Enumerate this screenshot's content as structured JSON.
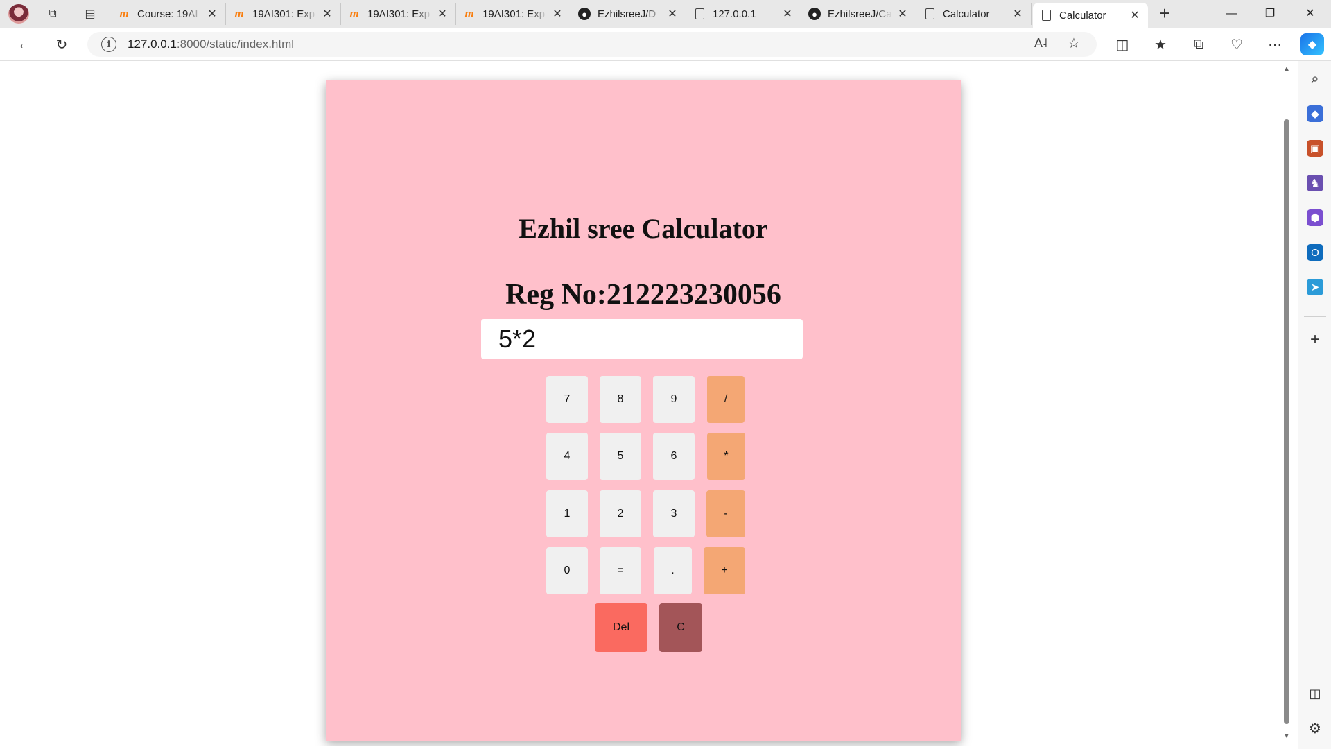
{
  "browser": {
    "tabs": [
      {
        "title": "Course: 19AI",
        "icon": "moodle-icon",
        "active": false
      },
      {
        "title": "19AI301: Exp",
        "icon": "moodle-icon",
        "active": false
      },
      {
        "title": "19AI301: Exp",
        "icon": "moodle-icon",
        "active": false
      },
      {
        "title": "19AI301: Exp",
        "icon": "moodle-icon",
        "active": false
      },
      {
        "title": "EzhilsreeJ/D",
        "icon": "github-icon",
        "active": false
      },
      {
        "title": "127.0.0.1",
        "icon": "page-icon",
        "active": false
      },
      {
        "title": "EzhilsreeJ/Ca",
        "icon": "github-icon",
        "active": false
      },
      {
        "title": "Calculator",
        "icon": "page-icon",
        "active": false
      },
      {
        "title": "Calculator",
        "icon": "page-icon",
        "active": true
      }
    ],
    "address": {
      "host": "127.0.0.1",
      "path": ":8000/static/index.html"
    }
  },
  "calculator": {
    "title": "Ezhil sree Calculator",
    "reg_no": "Reg No:212223230056",
    "display_value": "5*2",
    "keys": {
      "k7": "7",
      "k8": "8",
      "k9": "9",
      "div": "/",
      "k4": "4",
      "k5": "5",
      "k6": "6",
      "mul": "*",
      "k1": "1",
      "k2": "2",
      "k3": "3",
      "sub": "-",
      "k0": "0",
      "eq": "=",
      "dot": ".",
      "add": "+",
      "del": "Del",
      "clear": "C"
    },
    "colors": {
      "background": "#ffc0cb",
      "operator": "#f4a774",
      "digit": "#f0f0f0",
      "del": "#fa6a60",
      "clear": "#a35558"
    }
  }
}
